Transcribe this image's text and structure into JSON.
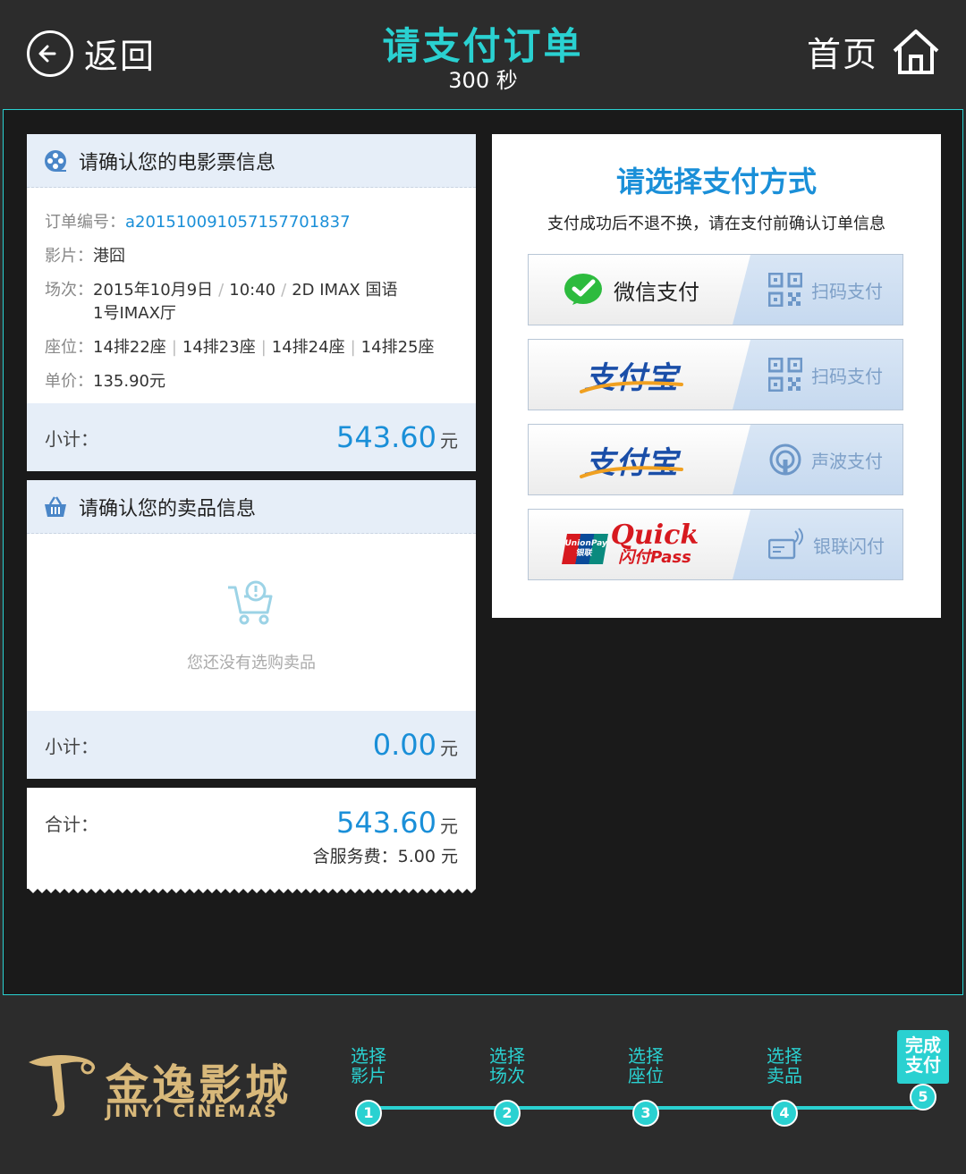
{
  "header": {
    "back_label": "返回",
    "title": "请支付订单",
    "timer": "300 秒",
    "home_label": "首页"
  },
  "ticket_card": {
    "title": "请确认您的电影票信息",
    "order_label": "订单编号：",
    "order_no": "a20151009105715770183 7",
    "order_no_clean": "a201510091057157701837",
    "movie_label": "影片：",
    "movie": "港囧",
    "session_label": "场次：",
    "session_date": "2015年10月9日",
    "session_time": "10:40",
    "session_format": "2D IMAX 国语",
    "session_hall": "1号IMAX厅",
    "seat_label": "座位：",
    "seats": [
      "14排22座",
      "14排23座",
      "14排24座",
      "14排25座"
    ],
    "price_label": "单价：",
    "price": "135.90元",
    "subtotal_label": "小计：",
    "subtotal_value": "543.60",
    "unit": "元"
  },
  "goods_card": {
    "title": "请确认您的卖品信息",
    "empty_text": "您还没有选购卖品",
    "subtotal_label": "小计：",
    "subtotal_value": "0.00",
    "unit": "元"
  },
  "total_card": {
    "total_label": "合计：",
    "total_value": "543.60",
    "unit": "元",
    "service_fee_label": "含服务费：",
    "service_fee_value": "5.00",
    "service_unit": "元"
  },
  "payment": {
    "title": "请选择支付方式",
    "subtitle": "支付成功后不退不换，请在支付前确认订单信息",
    "options": [
      {
        "brand": "微信支付",
        "action": "扫码支付"
      },
      {
        "brand": "支付宝",
        "action": "扫码支付"
      },
      {
        "brand": "支付宝",
        "action": "声波支付"
      },
      {
        "brand_logo1": "UnionPay",
        "brand_logo1b": "银联",
        "brand_logo2": "Quick",
        "brand_logo3": "闪付Pass",
        "action": "银联闪付"
      }
    ]
  },
  "footer": {
    "logo_cn": "金逸影城",
    "logo_en": "JINYI CINEMAS",
    "steps": [
      {
        "line1": "选择",
        "line2": "影片",
        "num": "1"
      },
      {
        "line1": "选择",
        "line2": "场次",
        "num": "2"
      },
      {
        "line1": "选择",
        "line2": "座位",
        "num": "3"
      },
      {
        "line1": "选择",
        "line2": "卖品",
        "num": "4"
      },
      {
        "line1": "完成",
        "line2": "支付",
        "num": "5"
      }
    ]
  },
  "colors": {
    "accent": "#2ad1d1",
    "price_blue": "#1a8fd8",
    "background": "#2c2c2c"
  }
}
